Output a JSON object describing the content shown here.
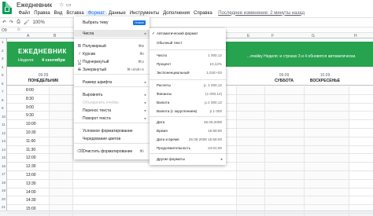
{
  "app": {
    "title": "Ежедневник",
    "brand_color": "#0f9d58"
  },
  "menubar": {
    "items": [
      "Файл",
      "Правка",
      "Вид",
      "Вставка",
      "Формат",
      "Данные",
      "Инструменты",
      "Дополнения",
      "Справка"
    ],
    "active": "Формат",
    "last_edit": "Последнее изменение: 2 минуты назад"
  },
  "toolbar": {
    "zoom": "100%"
  },
  "formula_bar": {
    "cell_ref": "O9",
    "fx": "fx"
  },
  "columns": [
    "A",
    "B",
    "C",
    "D",
    "E",
    "F",
    "G",
    "H"
  ],
  "row_numbers": [
    "1",
    "2",
    "3",
    "4",
    "5",
    "6",
    "7",
    "8",
    "9",
    "10",
    "11",
    "12",
    "13",
    "14",
    "15",
    "16",
    "17",
    "18",
    "19",
    "20",
    "21"
  ],
  "planner": {
    "title": "ЕЖЕДНЕВНИК",
    "week_label": "Неделя:",
    "week_value": "4 сентября",
    "band_color": "#27a24e",
    "band_note": "...ячейку Неделя: и строках 3 и 4 обновятся автоматически.",
    "days": [
      {
        "date": "09.09",
        "name": "ПОНЕДЕЛЬНИК"
      },
      {
        "date": "09.09",
        "name": "СУББОТА"
      },
      {
        "date": "10.09",
        "name": "ВОСКРЕСЕНЬЕ"
      }
    ],
    "times": [
      "8:00",
      "8:30",
      "9:00",
      "9:30",
      "10:00",
      "10:30",
      "11:00",
      "11:30",
      "12:00",
      "12:30",
      "13:00",
      "13:30",
      "14:00",
      "14:30",
      "15:00"
    ]
  },
  "format_menu": {
    "items": [
      {
        "icon": "",
        "label": "Выбрать тему",
        "badge": "Новое"
      },
      {
        "icon": "",
        "label": "Числа",
        "arrow": "▸",
        "highlight": true
      },
      {
        "icon": "B",
        "label": "Полужирный",
        "shortcut": "⌘B"
      },
      {
        "icon": "I",
        "label": "Курсив",
        "shortcut": "⌘I"
      },
      {
        "icon": "U",
        "label": "Подчеркнутый",
        "shortcut": "⌘U"
      },
      {
        "icon": "S",
        "label": "Зачеркнутый",
        "shortcut": "⌘+Shift+X"
      },
      {
        "icon": "",
        "label": "Размер шрифта",
        "arrow": "▸"
      },
      {
        "icon": "",
        "label": "Выровнять",
        "arrow": "▸"
      },
      {
        "icon": "",
        "label": "Объединить ячейки",
        "arrow": "▸",
        "disabled": true
      },
      {
        "icon": "",
        "label": "Перенос текста",
        "arrow": "▸"
      },
      {
        "icon": "",
        "label": "Поворот текста",
        "arrow": "▸"
      },
      {
        "icon": "",
        "label": "Условное форматирование"
      },
      {
        "icon": "",
        "label": "Чередование цветов"
      },
      {
        "icon": "⌫",
        "label": "Очистить форматирование",
        "shortcut": "⌘\\"
      }
    ]
  },
  "number_menu": {
    "items": [
      {
        "check": "✓",
        "label": "Автоматический формат"
      },
      {
        "label": "Обычный текст"
      },
      {
        "label": "Число",
        "example": "1 000,12"
      },
      {
        "label": "Процент",
        "example": "10,12%"
      },
      {
        "label": "Экспоненциальный",
        "example": "1,01E+03"
      },
      {
        "label": "Расчеты",
        "example": "р. 1 000,12"
      },
      {
        "label": "Финансы",
        "example": "(1 000,12)"
      },
      {
        "label": "Валюта",
        "example": "р.1 000,12"
      },
      {
        "label": "Валюта (с округлением)",
        "example": "р.1 000"
      },
      {
        "label": "Дата",
        "example": "26.09.2008"
      },
      {
        "label": "Время",
        "example": "15:59:00"
      },
      {
        "label": "Дата и время",
        "example": "26.09.2008 15:59:00"
      },
      {
        "label": "Продолжительность",
        "example": "24:01:00"
      },
      {
        "label": "Другие форматы",
        "arrow": "▸"
      }
    ]
  }
}
